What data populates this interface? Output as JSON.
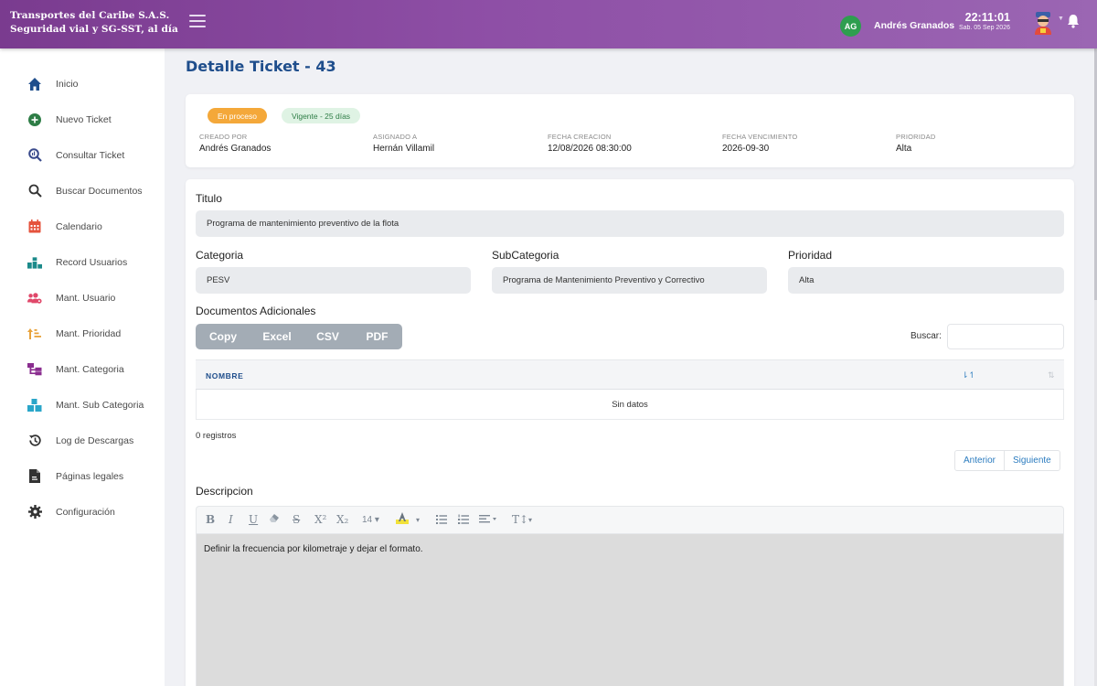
{
  "header": {
    "company_line1": "Transportes del Caribe S.A.S.",
    "company_line2": "Seguridad vial y SG-SST, al día",
    "avatar_initials": "AG",
    "user_name": "Andrés Granados",
    "time": "22:11:01",
    "date": "Sab. 05 Sep 2026",
    "icons": [
      "menu-icon",
      "user-icon",
      "bell-icon"
    ]
  },
  "sidebar": {
    "items": [
      {
        "label": "Inicio",
        "icon": "home-icon",
        "color": "#1f4e8c"
      },
      {
        "label": "Nuevo Ticket",
        "icon": "plus-circle-icon",
        "color": "#2e7d46"
      },
      {
        "label": "Consultar Ticket",
        "icon": "magnifier-chart-icon",
        "color": "#3a4a8c"
      },
      {
        "label": "Buscar Documentos",
        "icon": "search-icon",
        "color": "#333333"
      },
      {
        "label": "Calendario",
        "icon": "calendar-icon",
        "color": "#e5533d"
      },
      {
        "label": "Record Usuarios",
        "icon": "podium-icon",
        "color": "#1b8a8a"
      },
      {
        "label": "Mant. Usuario",
        "icon": "users-cog-icon",
        "color": "#e0486a"
      },
      {
        "label": "Mant. Prioridad",
        "icon": "sort-priority-icon",
        "color": "#e8a23a"
      },
      {
        "label": "Mant. Categoria",
        "icon": "sitemap-icon",
        "color": "#8a2d8f"
      },
      {
        "label": "Mant. Sub Categoria",
        "icon": "cubes-icon",
        "color": "#2aa6c9"
      },
      {
        "label": "Log de Descargas",
        "icon": "history-icon",
        "color": "#333333"
      },
      {
        "label": "Páginas legales",
        "icon": "file-legal-icon",
        "color": "#333333"
      },
      {
        "label": "Configuración",
        "icon": "gear-icon",
        "color": "#333333"
      }
    ]
  },
  "page": {
    "title": "Detalle Ticket - 43"
  },
  "summary": {
    "status": "En proceso",
    "validity": "Vigente - 25 días",
    "fields": [
      {
        "key": "CREADO POR",
        "value": "Andrés Granados"
      },
      {
        "key": "ASIGNADO A",
        "value": "Hernán Villamil"
      },
      {
        "key": "FECHA CREACION",
        "value": "12/08/2026 08:30:00"
      },
      {
        "key": "FECHA VENCIMIENTO",
        "value": "2026-09-30"
      },
      {
        "key": "PRIORIDAD",
        "value": "Alta"
      }
    ]
  },
  "form": {
    "titulo_label": "Titulo",
    "titulo_value": "Programa de mantenimiento preventivo de la flota",
    "categoria_label": "Categoria",
    "categoria_value": "PESV",
    "subcategoria_label": "SubCategoria",
    "subcategoria_value": "Programa de Mantenimiento Preventivo y Correctivo",
    "prioridad_label": "Prioridad",
    "prioridad_value": "Alta"
  },
  "documents": {
    "section_label": "Documentos Adicionales",
    "export_buttons": [
      "Copy",
      "Excel",
      "CSV",
      "PDF"
    ],
    "search_label": "Buscar:",
    "search_value": "",
    "column_header": "NOMBRE",
    "empty_text": "Sin datos",
    "count_text": "0 registros",
    "prev_label": "Anterior",
    "next_label": "Siguiente"
  },
  "description": {
    "label": "Descripcion",
    "toolbar": [
      "B",
      "I",
      "U",
      "eraser",
      "S",
      "X²",
      "X₂",
      "14",
      "A",
      "ul",
      "ol",
      "align",
      "T↕"
    ],
    "font_size": "14",
    "content": "Definir la frecuencia por kilometraje y dejar el formato."
  },
  "colors": {
    "header_start": "#7a3b8f",
    "header_end": "#9b66b3",
    "title_blue": "#1f4e8c",
    "status_orange": "#f4a83a",
    "validity_green": "#2e7d46"
  }
}
